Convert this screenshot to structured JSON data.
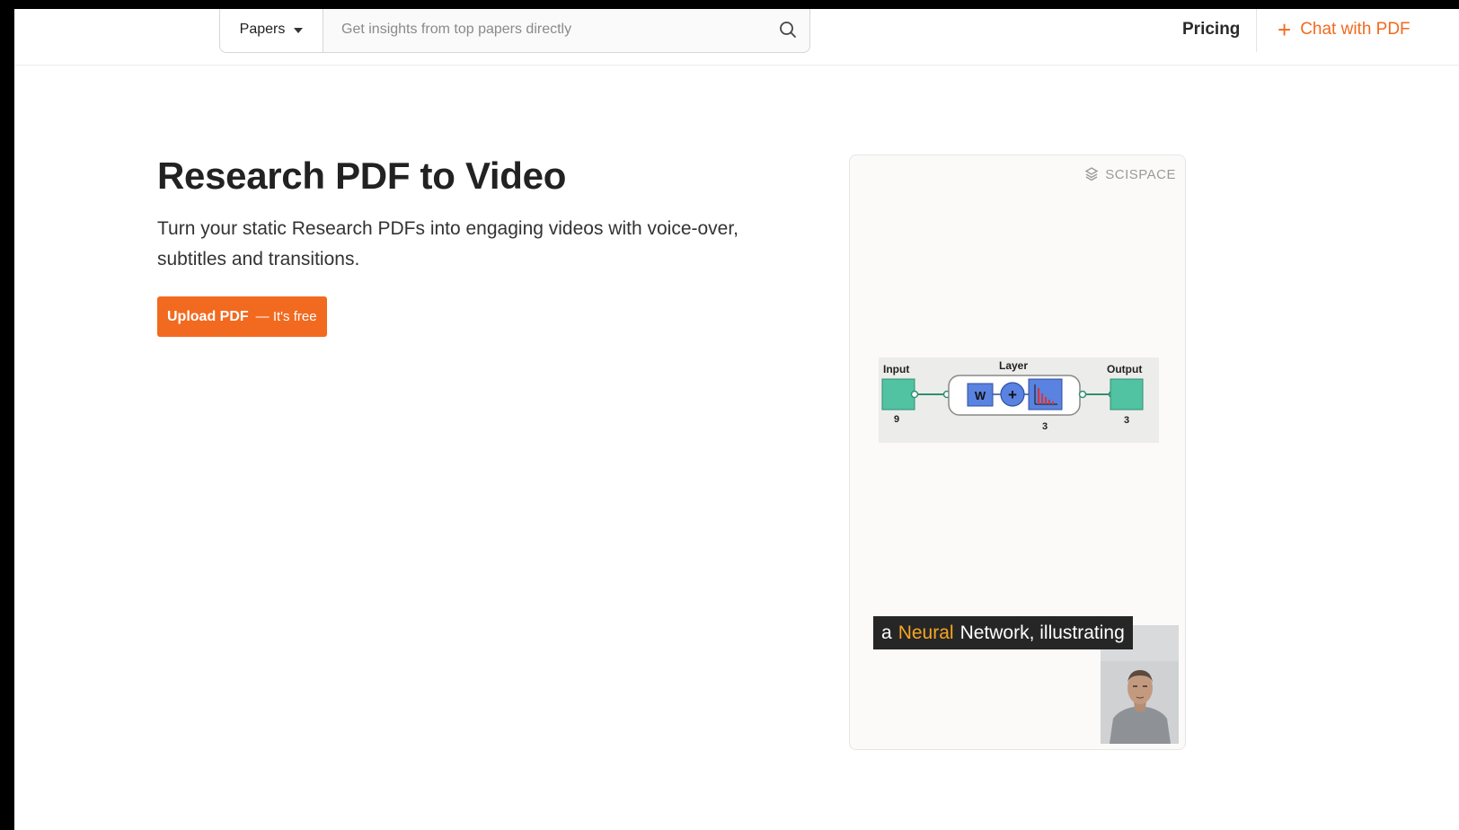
{
  "header": {
    "category_select": "Papers",
    "search": {
      "placeholder": "Get insights from top papers directly",
      "value": ""
    },
    "nav": {
      "pricing": "Pricing",
      "chat": "Chat with PDF"
    }
  },
  "hero": {
    "title": "Research PDF to Video",
    "description": "Turn your static Research PDFs into engaging videos with voice-over, subtitles and transitions.",
    "cta": {
      "label": "Upload PDF",
      "sublabel": "— It's free"
    }
  },
  "video_preview": {
    "brand": "SCISPACE",
    "diagram": {
      "input_label": "Input",
      "layer_label": "Layer",
      "output_label": "Output",
      "input_size": "9",
      "layer_size": "3",
      "output_size": "3",
      "weight_label": "W",
      "sum_label": "+"
    },
    "subtitle": {
      "word1": "a",
      "highlight": "Neural",
      "rest": "Network, illustrating"
    }
  },
  "colors": {
    "accent": "#f26a1f",
    "subtitle_highlight": "#f5a623",
    "node_green": "#52c3a2",
    "node_blue": "#5a82e0"
  }
}
